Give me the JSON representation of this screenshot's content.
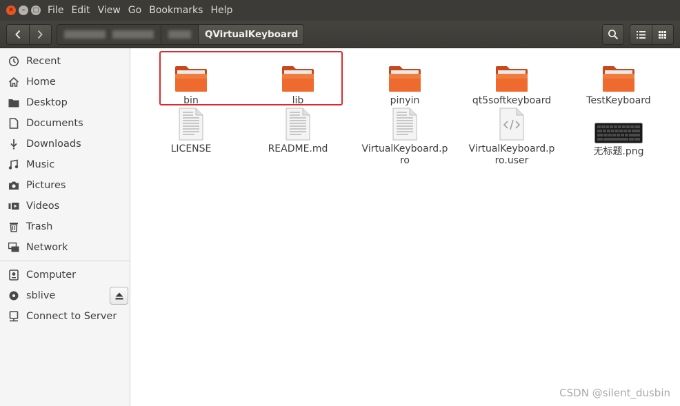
{
  "window": {
    "controls": [
      "close-icon",
      "minimize-icon",
      "maximize-icon"
    ]
  },
  "menu": [
    "File",
    "Edit",
    "View",
    "Go",
    "Bookmarks",
    "Help"
  ],
  "toolbar": {
    "current_folder": "QVirtualKeyboard"
  },
  "sidebar": {
    "places": [
      {
        "label": "Recent",
        "icon": "clock-icon"
      },
      {
        "label": "Home",
        "icon": "home-icon"
      },
      {
        "label": "Desktop",
        "icon": "folder-icon"
      },
      {
        "label": "Documents",
        "icon": "document-icon"
      },
      {
        "label": "Downloads",
        "icon": "download-icon"
      },
      {
        "label": "Music",
        "icon": "music-icon"
      },
      {
        "label": "Pictures",
        "icon": "camera-icon"
      },
      {
        "label": "Videos",
        "icon": "video-icon"
      },
      {
        "label": "Trash",
        "icon": "trash-icon"
      },
      {
        "label": "Network",
        "icon": "network-icon"
      }
    ],
    "devices": [
      {
        "label": "Computer",
        "icon": "computer-icon"
      },
      {
        "label": "sblive",
        "icon": "disc-icon"
      },
      {
        "label": "Connect to Server",
        "icon": "server-icon"
      }
    ]
  },
  "files": {
    "items": [
      {
        "name": "bin",
        "type": "folder"
      },
      {
        "name": "lib",
        "type": "folder"
      },
      {
        "name": "pinyin",
        "type": "folder"
      },
      {
        "name": "qt5softkeyboard",
        "type": "folder"
      },
      {
        "name": "TestKeyboard",
        "type": "folder"
      },
      {
        "name": "LICENSE",
        "type": "text"
      },
      {
        "name": "README.md",
        "type": "text"
      },
      {
        "name": "VirtualKeyboard.pro",
        "type": "text"
      },
      {
        "name": "VirtualKeyboard.pro.user",
        "type": "code"
      },
      {
        "name": "无标题.png",
        "type": "image"
      }
    ]
  },
  "watermark": "CSDN @silent_dusbin",
  "colors": {
    "folder": "#e8622b",
    "highlight": "#e3262b",
    "titlebar": "#3c3b37"
  }
}
